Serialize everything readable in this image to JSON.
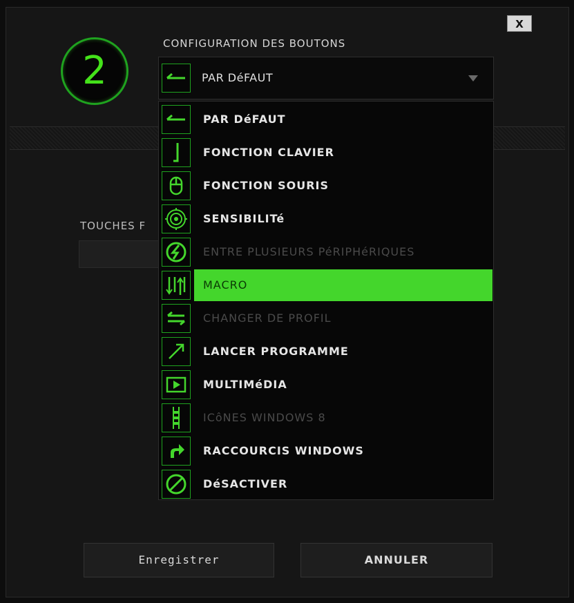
{
  "dialog": {
    "close_label": "X",
    "button_number": "2",
    "section_title": "CONFIGURATION DES BOUTONS",
    "under_label": "TOUCHES F"
  },
  "select": {
    "value": "PAR DéFAUT",
    "icon": "default-arrow-icon"
  },
  "menu": {
    "items": [
      {
        "label": "PAR DéFAUT",
        "icon": "default-arrow-icon",
        "state": "normal"
      },
      {
        "label": "FONCTION CLAVIER",
        "icon": "keyboard-function-icon",
        "state": "normal"
      },
      {
        "label": "FONCTION SOURIS",
        "icon": "mouse-icon",
        "state": "normal"
      },
      {
        "label": "SENSIBILITé",
        "icon": "sensitivity-target-icon",
        "state": "normal"
      },
      {
        "label": "ENTRE PLUSIEURS PéRIPHéRIQUES",
        "icon": "inter-device-icon",
        "state": "disabled"
      },
      {
        "label": "MACRO",
        "icon": "macro-icon",
        "state": "selected"
      },
      {
        "label": "CHANGER DE PROFIL",
        "icon": "switch-profile-icon",
        "state": "disabled"
      },
      {
        "label": "LANCER PROGRAMME",
        "icon": "launch-program-icon",
        "state": "normal"
      },
      {
        "label": "MULTIMéDIA",
        "icon": "multimedia-play-icon",
        "state": "normal"
      },
      {
        "label": "ICôNES WINDOWS 8",
        "icon": "windows8-charms-icon",
        "state": "disabled"
      },
      {
        "label": "RACCOURCIS WINDOWS",
        "icon": "windows-shortcut-icon",
        "state": "normal"
      },
      {
        "label": "DéSACTIVER",
        "icon": "disable-icon",
        "state": "normal"
      }
    ]
  },
  "actions": {
    "save_label": "Enregistrer",
    "cancel_label": "ANNULER"
  },
  "colors": {
    "accent": "#44d62c",
    "icon_green": "#1fa31f",
    "background": "#161616",
    "disabled_text": "#4a4a4a"
  }
}
